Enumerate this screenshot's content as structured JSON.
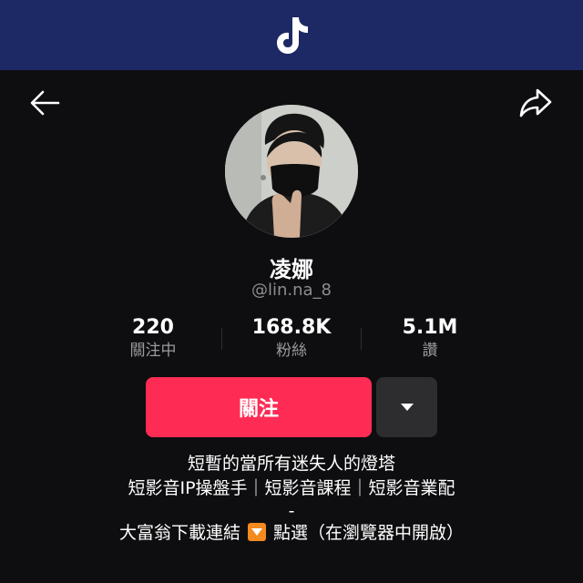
{
  "app": {
    "logo_icon": "tiktok-logo-icon",
    "header_color": "#1c2964"
  },
  "nav": {
    "back_icon": "back-arrow-icon",
    "share_icon": "share-icon"
  },
  "profile": {
    "avatar_icon": "profile-avatar",
    "name": "凌娜",
    "handle": "@lin.na_8"
  },
  "stats": [
    {
      "value": "220",
      "label": "關注中"
    },
    {
      "value": "168.8K",
      "label": "粉絲"
    },
    {
      "value": "5.1M",
      "label": "讚"
    }
  ],
  "actions": {
    "follow_label": "關注",
    "follow_color": "#fe2c55",
    "more_icon": "dropdown-triangle-icon"
  },
  "bio": {
    "line1": "短暫的當所有迷失人的燈塔",
    "line2": "短影音IP操盤手｜短影音課程｜短影音業配",
    "line3": "-",
    "line4_before": "大富翁下載連結 ",
    "line4_icon": "down-arrow-emoji-icon",
    "line4_after": " 點選（在瀏覽器中開啟）"
  }
}
